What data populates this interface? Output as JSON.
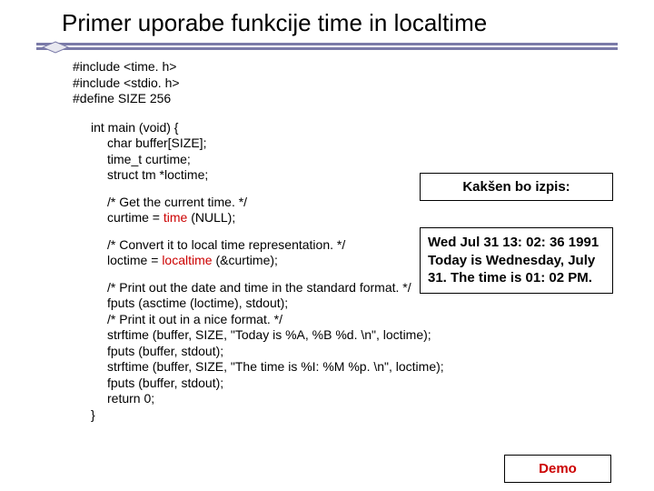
{
  "title": "Primer uporabe funkcije time in localtime",
  "includes": {
    "l1": "#include <time. h>",
    "l2": "#include <stdio. h>",
    "l3": "#define SIZE 256"
  },
  "code": {
    "l1": "int main (void)   {",
    "l2": "char buffer[SIZE];",
    "l3": "time_t curtime;",
    "l4": "struct tm *loctime;",
    "l5": "/* Get the current time. */",
    "l6a": "curtime = ",
    "l6fn": "time",
    "l6b": " (NULL);",
    "l7": "/* Convert it to local time representation. */",
    "l8a": "loctime = ",
    "l8fn": "localtime",
    "l8b": " (&curtime);",
    "l9": "/* Print out the date and time in the standard format. */",
    "l10": "fputs (asctime (loctime), stdout);",
    "l11": "/* Print it out in a nice format. */",
    "l12": "strftime (buffer, SIZE, \"Today is %A, %B %d. \\n\", loctime);",
    "l13": "fputs (buffer, stdout);",
    "l14": "strftime (buffer, SIZE, \"The time is %I: %M %p. \\n\", loctime);",
    "l15": "fputs (buffer, stdout);",
    "l16": "return 0;",
    "l17": "}"
  },
  "box1": "Kakšen bo izpis:",
  "box2_l1": "Wed Jul 31 13: 02: 36 1991",
  "box2_l2": "Today is Wednesday, July 31. The time is 01: 02 PM.",
  "box3": "Demo"
}
